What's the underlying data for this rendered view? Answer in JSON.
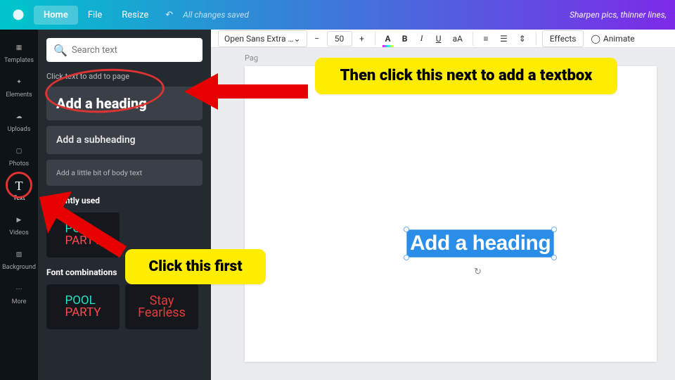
{
  "topbar": {
    "home": "Home",
    "file": "File",
    "resize": "Resize",
    "status": "All changes saved",
    "rightText": "Sharpen pics, thinner lines,"
  },
  "rail": {
    "templates": "Templates",
    "elements": "Elements",
    "uploads": "Uploads",
    "photos": "Photos",
    "text": "Text",
    "videos": "Videos",
    "background": "Background",
    "more": "More"
  },
  "panel": {
    "searchPlaceholder": "Search text",
    "clickLabel": "Click text to add to page",
    "addHeading": "Add a heading",
    "addSubheading": "Add a subheading",
    "addBody": "Add a little bit of body text",
    "recentlyUsed": "Recently used",
    "fontCombos": "Font combinations",
    "pool": "POOL",
    "party": "PARTY",
    "stay": "Stay",
    "fearless": "Fearless"
  },
  "toolbar": {
    "font": "Open Sans Extra …",
    "size": "50",
    "effects": "Effects",
    "animate": "Animate"
  },
  "canvas": {
    "pageLabel": "Pag",
    "selectedText": "Add a heading"
  },
  "callouts": {
    "first": "Click this first",
    "second": "Then click this next to add a textbox"
  }
}
